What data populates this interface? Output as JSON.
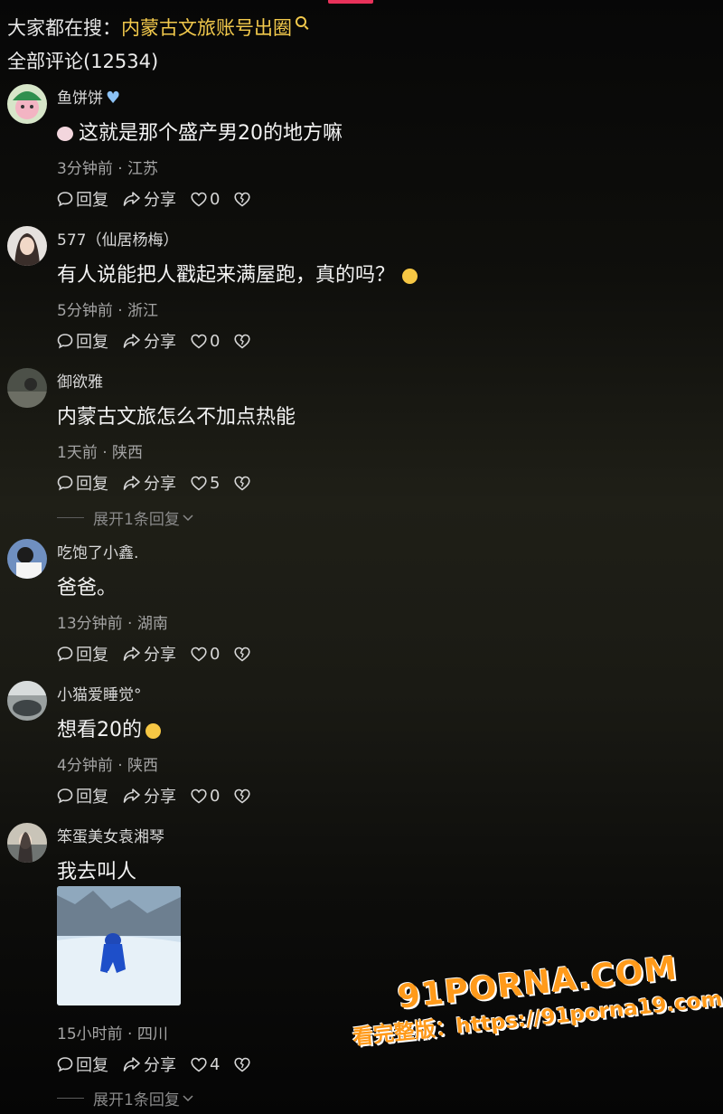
{
  "search": {
    "prefix": "大家都在搜：",
    "term": "内蒙古文旅账号出圈"
  },
  "comments_header": "全部评论(12534)",
  "comments": [
    {
      "name": "鱼饼饼",
      "text": "这就是那个盛产男20的地方嘛",
      "meta": "3分钟前 · 江苏",
      "reply_label": "回复",
      "share_label": "分享",
      "likes": "0"
    },
    {
      "name": "577（仙居杨梅）",
      "text": "有人说能把人戳起来满屋跑，真的吗？",
      "meta": "5分钟前 · 浙江",
      "reply_label": "回复",
      "share_label": "分享",
      "likes": "0"
    },
    {
      "name": "御欲雅",
      "text": "内蒙古文旅怎么不加点热能",
      "meta": "1天前 · 陕西",
      "reply_label": "回复",
      "share_label": "分享",
      "likes": "5",
      "expand": "展开1条回复"
    },
    {
      "name": "吃饱了小鑫.",
      "text": "爸爸。",
      "meta": "13分钟前 · 湖南",
      "reply_label": "回复",
      "share_label": "分享",
      "likes": "0"
    },
    {
      "name": "小猫爱睡觉°",
      "text": "想看20的",
      "meta": "4分钟前 · 陕西",
      "reply_label": "回复",
      "share_label": "分享",
      "likes": "0"
    },
    {
      "name": "笨蛋美女袁湘琴",
      "text": "我去叫人",
      "meta": "15小时前 · 四川",
      "reply_label": "回复",
      "share_label": "分享",
      "likes": "4",
      "expand": "展开1条回复"
    }
  ],
  "watermark": {
    "logo": "91PORNA.COM",
    "url": "看完整版：https://91porna19.com"
  },
  "colors": {
    "accent_search": "#f2c94c",
    "indicator": "#e8325a",
    "watermark": "#ff9a1a"
  }
}
